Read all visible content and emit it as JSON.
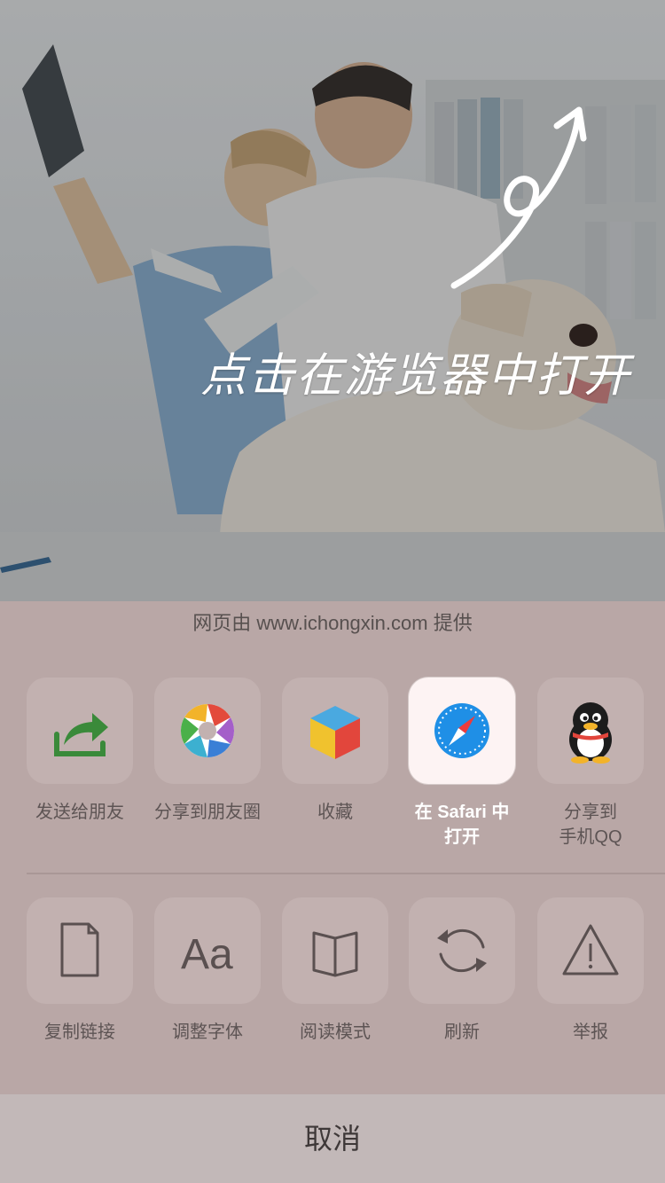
{
  "overlay": {
    "hint_text": "点击在游览器中打开"
  },
  "share_sheet": {
    "provider_text": "网页由 www.ichongxin.com 提供",
    "row1": [
      {
        "label": "发送给朋友",
        "icon": "send-to-friend-icon"
      },
      {
        "label": "分享到朋友圈",
        "icon": "moments-icon"
      },
      {
        "label": "收藏",
        "icon": "favorites-icon"
      },
      {
        "label": "在 Safari 中\n打开",
        "icon": "safari-icon"
      },
      {
        "label": "分享到\n手机QQ",
        "icon": "qq-icon"
      }
    ],
    "row2": [
      {
        "label": "复制链接",
        "icon": "document-icon"
      },
      {
        "label": "调整字体",
        "icon": "font-size-icon"
      },
      {
        "label": "阅读模式",
        "icon": "book-icon"
      },
      {
        "label": "刷新",
        "icon": "refresh-icon"
      },
      {
        "label": "举报",
        "icon": "warning-icon"
      }
    ],
    "cancel_label": "取消"
  },
  "colors": {
    "sheet_bg": "#b9a7a6",
    "tile_bg": "#c2b1b0",
    "active_tile_bg": "#fdf3f3",
    "label": "#5d5454",
    "wechat_green": "#3a8a3a",
    "safari_blue": "#1f8fe6"
  }
}
